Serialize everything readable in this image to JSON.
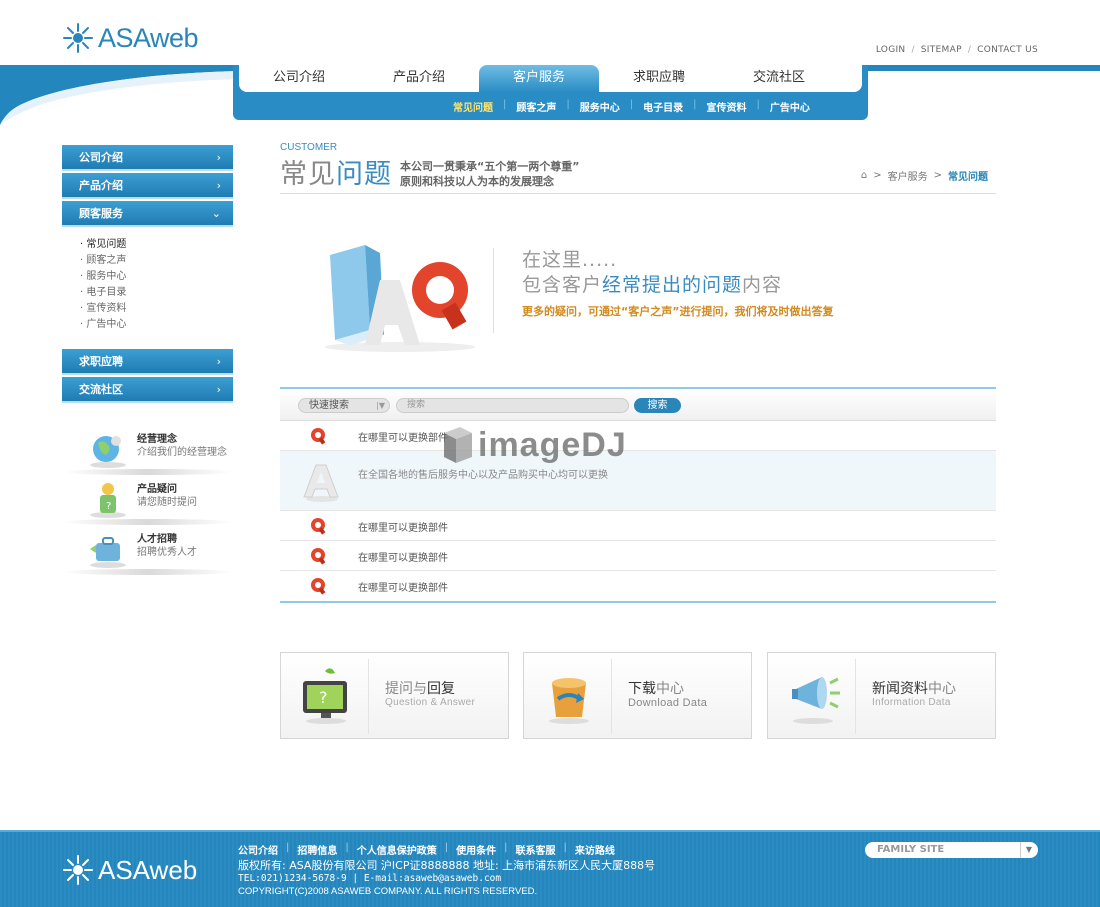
{
  "header": {
    "logo_text": "ASAweb",
    "top_links": [
      "LOGIN",
      "SITEMAP",
      "CONTACT US"
    ],
    "nav_tabs": [
      "公司介绍",
      "产品介绍",
      "客户服务",
      "求职应聘",
      "交流社区"
    ],
    "active_tab": "客户服务",
    "sub_nav": [
      "常见问题",
      "顾客之声",
      "服务中心",
      "电子目录",
      "宣传资料",
      "广告中心"
    ],
    "active_sub": "常见问题"
  },
  "sidebar": {
    "menus_top": [
      "公司介绍",
      "产品介绍",
      "顾客服务"
    ],
    "sub_items": [
      "· 常见问题",
      "· 顾客之声",
      "· 服务中心",
      "·  电子目录",
      "· 宣传资料",
      "· 广告中心"
    ],
    "menus_bottom": [
      "求职应聘",
      "交流社区"
    ],
    "promos": [
      {
        "title": "经营理念",
        "desc": "介绍我们的经营理念"
      },
      {
        "title": "产品疑问",
        "desc": "请您随时提问"
      },
      {
        "title": "人才招聘",
        "desc": "招聘优秀人才"
      }
    ]
  },
  "page": {
    "title_en": "CUSTOMER",
    "title_grey": "常见",
    "title_blue": "问题",
    "slogan_line1": "本公司一贯秉承“五个第一两个尊重”",
    "slogan_line2": "原则和科技以人为本的发展理念",
    "breadcrumb": [
      "客户服务",
      "常见问题"
    ]
  },
  "hero": {
    "line1": "在这里.....",
    "line2_a": "包含客户",
    "line2_b": "经常提出的问题",
    "line2_c": "内容",
    "line3": "更多的疑问，可通过“客户之声”进行提问，我们将及时做出答复"
  },
  "search": {
    "quick_label": "快速搜索",
    "placeholder": "搜索",
    "button": "搜索"
  },
  "faq": {
    "q1": "在哪里可以更换部件",
    "answer": "在全国各地的售后服务中心以及产品购买中心均可以更换",
    "q2": "在哪里可以更换部件",
    "q3": "在哪里可以更换部件",
    "q4": "在哪里可以更换部件"
  },
  "watermark": "imageDJ",
  "cards": [
    {
      "title_a": "提问与",
      "title_b": "回复",
      "sub": "Question  &  Answer"
    },
    {
      "title_a": "下载",
      "title_b": "中心",
      "sub": "Download Data"
    },
    {
      "title_a": "新闻资料",
      "title_b": "中心",
      "sub": "Information  Data"
    }
  ],
  "footer": {
    "logo_text": "ASAweb",
    "links": [
      "公司介绍",
      "招聘信息",
      "个人信息保护政策",
      "使用条件",
      "联系客服",
      "来访路线"
    ],
    "line1": "版权所有: ASA股份有限公司 沪ICP证8888888 地址: 上海市浦东新区人民大厦888号",
    "line2": "TEL:021)1234-5678-9 | E-mail:asaweb@asaweb.com",
    "line3": "COPYRIGHT(C)2008 ASAWEB COMPANY. ALL RIGHTS RESERVED.",
    "family_site": "FAMILY SITE"
  },
  "colors": {
    "brand": "#2386bd",
    "accent": "#d28a1e",
    "highlight": "#ffe36b"
  }
}
